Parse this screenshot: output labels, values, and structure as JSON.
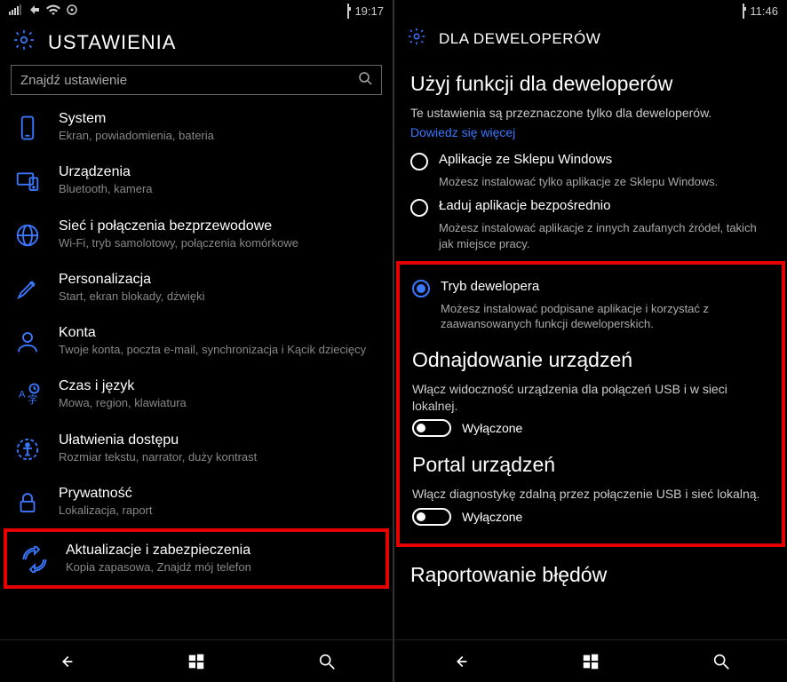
{
  "left": {
    "statusbar": {
      "time": "19:17"
    },
    "header": {
      "title": "USTAWIENIA"
    },
    "search": {
      "placeholder": "Znajdź ustawienie"
    },
    "items": [
      {
        "title": "System",
        "sub": "Ekran, powiadomienia, bateria"
      },
      {
        "title": "Urządzenia",
        "sub": "Bluetooth, kamera"
      },
      {
        "title": "Sieć i połączenia bezprzewodowe",
        "sub": "Wi-Fi, tryb samolotowy, połączenia komórkowe"
      },
      {
        "title": "Personalizacja",
        "sub": "Start, ekran blokady, dźwięki"
      },
      {
        "title": "Konta",
        "sub": "Twoje konta, poczta e-mail, synchronizacja i Kącik dziecięcy"
      },
      {
        "title": "Czas i język",
        "sub": "Mowa, region, klawiatura"
      },
      {
        "title": "Ułatwienia dostępu",
        "sub": "Rozmiar tekstu, narrator, duży kontrast"
      },
      {
        "title": "Prywatność",
        "sub": "Lokalizacja, raport"
      },
      {
        "title": "Aktualizacje i zabezpieczenia",
        "sub": "Kopia zapasowa, Znajdź mój telefon"
      }
    ]
  },
  "right": {
    "statusbar": {
      "time": "11:46"
    },
    "header": {
      "title": "DLA DEWELOPERÓW"
    },
    "heading1": "Użyj funkcji dla deweloperów",
    "intro": "Te ustawienia są przeznaczone tylko dla deweloperów.",
    "learn_more": "Dowiedz się więcej",
    "radios": [
      {
        "label": "Aplikacje ze Sklepu Windows",
        "desc": "Możesz instalować tylko aplikacje ze Sklepu Windows.",
        "selected": false
      },
      {
        "label": "Ładuj aplikacje bezpośrednio",
        "desc": "Możesz instalować aplikacje z innych zaufanych źródeł, takich jak miejsce pracy.",
        "selected": false
      },
      {
        "label": "Tryb dewelopera",
        "desc": "Możesz instalować podpisane aplikacje i korzystać z zaawansowanych funkcji deweloperskich.",
        "selected": true
      }
    ],
    "section_discovery": {
      "heading": "Odnajdowanie urządzeń",
      "desc": "Włącz widoczność urządzenia dla połączeń USB i w sieci lokalnej.",
      "toggle_label": "Wyłączone"
    },
    "section_portal": {
      "heading": "Portal urządzeń",
      "desc": "Włącz diagnostykę zdalną przez połączenie USB i sieć lokalną.",
      "toggle_label": "Wyłączone"
    },
    "section_errors": {
      "heading": "Raportowanie błędów"
    }
  }
}
